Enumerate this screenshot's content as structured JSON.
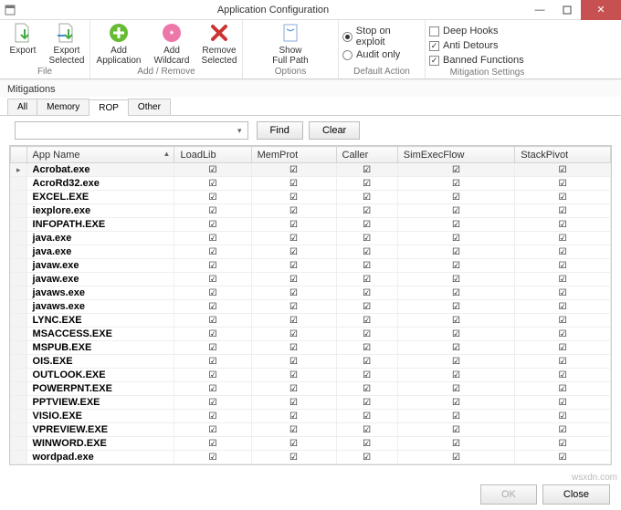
{
  "window": {
    "title": "Application Configuration"
  },
  "ribbon": {
    "file": {
      "title": "File",
      "export": "Export",
      "export_selected": "Export\nSelected"
    },
    "addremove": {
      "title": "Add / Remove",
      "add_app": "Add Application",
      "add_wc": "Add Wildcard",
      "remove": "Remove\nSelected"
    },
    "options": {
      "title": "Options",
      "show_path": "Show Full\nPath"
    },
    "default_action": {
      "title": "Default Action",
      "stop": "Stop on exploit",
      "audit": "Audit only"
    },
    "mitigation": {
      "title": "Mitigation Settings",
      "deep_hooks": "Deep Hooks",
      "anti_detours": "Anti Detours",
      "banned": "Banned Functions"
    }
  },
  "section": "Mitigations",
  "tabs": {
    "all": "All",
    "memory": "Memory",
    "rop": "ROP",
    "other": "Other"
  },
  "finder": {
    "placeholder": "",
    "find": "Find",
    "clear": "Clear"
  },
  "columns": [
    "App Name",
    "LoadLib",
    "MemProt",
    "Caller",
    "SimExecFlow",
    "StackPivot"
  ],
  "rows": [
    {
      "name": "Acrobat.exe",
      "v": [
        true,
        true,
        true,
        true,
        true
      ]
    },
    {
      "name": "AcroRd32.exe",
      "v": [
        true,
        true,
        true,
        true,
        true
      ]
    },
    {
      "name": "EXCEL.EXE",
      "v": [
        true,
        true,
        true,
        true,
        true
      ]
    },
    {
      "name": "iexplore.exe",
      "v": [
        true,
        true,
        true,
        true,
        true
      ]
    },
    {
      "name": "INFOPATH.EXE",
      "v": [
        true,
        true,
        true,
        true,
        true
      ]
    },
    {
      "name": "java.exe",
      "v": [
        true,
        true,
        true,
        true,
        true
      ]
    },
    {
      "name": "java.exe",
      "v": [
        true,
        true,
        true,
        true,
        true
      ]
    },
    {
      "name": "javaw.exe",
      "v": [
        true,
        true,
        true,
        true,
        true
      ]
    },
    {
      "name": "javaw.exe",
      "v": [
        true,
        true,
        true,
        true,
        true
      ]
    },
    {
      "name": "javaws.exe",
      "v": [
        true,
        true,
        true,
        true,
        true
      ]
    },
    {
      "name": "javaws.exe",
      "v": [
        true,
        true,
        true,
        true,
        true
      ]
    },
    {
      "name": "LYNC.EXE",
      "v": [
        true,
        true,
        true,
        true,
        true
      ]
    },
    {
      "name": "MSACCESS.EXE",
      "v": [
        true,
        true,
        true,
        true,
        true
      ]
    },
    {
      "name": "MSPUB.EXE",
      "v": [
        true,
        true,
        true,
        true,
        true
      ]
    },
    {
      "name": "OIS.EXE",
      "v": [
        true,
        true,
        true,
        true,
        true
      ]
    },
    {
      "name": "OUTLOOK.EXE",
      "v": [
        true,
        true,
        true,
        true,
        true
      ]
    },
    {
      "name": "POWERPNT.EXE",
      "v": [
        true,
        true,
        true,
        true,
        true
      ]
    },
    {
      "name": "PPTVIEW.EXE",
      "v": [
        true,
        true,
        true,
        true,
        true
      ]
    },
    {
      "name": "VISIO.EXE",
      "v": [
        true,
        true,
        true,
        true,
        true
      ]
    },
    {
      "name": "VPREVIEW.EXE",
      "v": [
        true,
        true,
        true,
        true,
        true
      ]
    },
    {
      "name": "WINWORD.EXE",
      "v": [
        true,
        true,
        true,
        true,
        true
      ]
    },
    {
      "name": "wordpad.exe",
      "v": [
        true,
        true,
        true,
        true,
        true
      ]
    }
  ],
  "footer": {
    "ok": "OK",
    "close": "Close"
  },
  "watermark": "wsxdn.com"
}
